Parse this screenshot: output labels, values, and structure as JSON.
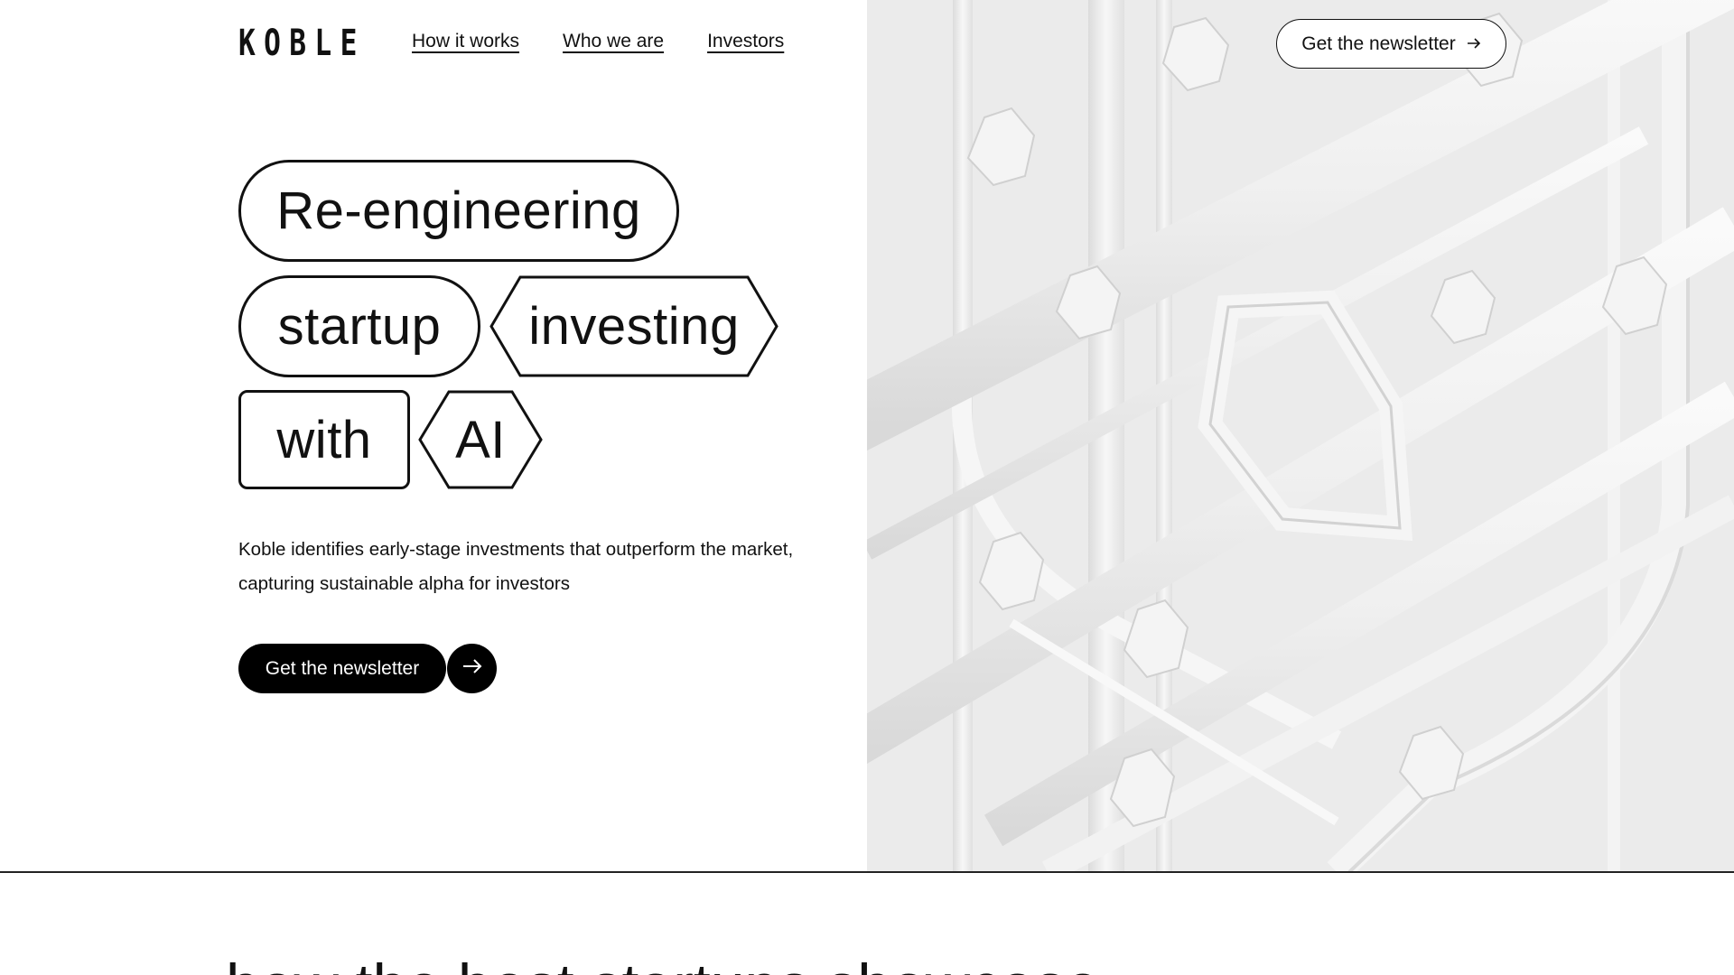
{
  "brand": {
    "logo_text": "KOBLE"
  },
  "nav": {
    "items": [
      {
        "label": "How it works"
      },
      {
        "label": "Who we are"
      },
      {
        "label": "Investors"
      }
    ]
  },
  "header": {
    "cta_label": "Get the newsletter",
    "cta_icon": "arrow-right-icon"
  },
  "hero": {
    "headline_words": [
      "Re-engineering",
      "startup",
      "investing",
      "with",
      "AI"
    ],
    "description": "Koble identifies early-stage investments that outperform the market, capturing sustainable alpha for investors",
    "cta_label": "Get the newsletter",
    "cta_icon": "arrow-right-icon",
    "image": "abstract-white-3d-pipes-illustration"
  },
  "next_section": {
    "heading": "how the best startups showcase"
  },
  "colors": {
    "text": "#111111",
    "button_bg": "#000000",
    "button_text": "#ffffff",
    "art_bg": "#e9e9e9"
  }
}
